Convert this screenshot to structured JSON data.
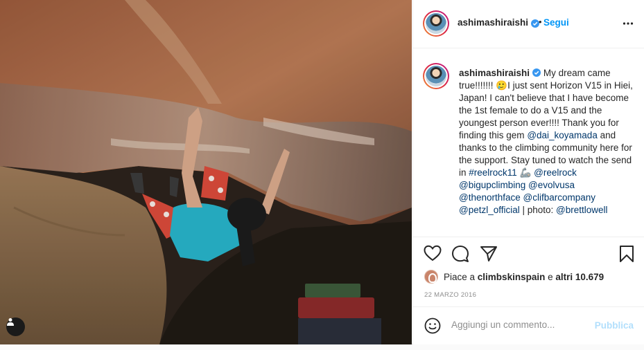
{
  "post": {
    "username": "ashimashiraishi",
    "verified_icon": "verified-badge-icon",
    "separator": "•",
    "follow_label": "Segui",
    "more_icon": "more-options-icon",
    "caption": {
      "username": "ashimashiraishi",
      "t1": "My dream came true!!!!!!! 🥲I just sent Horizon V15 in Hiei, Japan! I can't believe that I have become the 1st female to do a V15 and the youngest person ever!!!! Thank you for finding this gem ",
      "m_dai": "@dai_koyamada",
      "t2": " and thanks to the climbing community here for the support. Stay tuned to watch the send in ",
      "h_reelrock": "#reelrock11",
      "t3": " 🦾 ",
      "m_reelrock": "@reelrock",
      "m_bigup": "@bigupclimbing",
      "m_evolv": "@evolvusa",
      "m_tnf": "@thenorthface",
      "m_clif": "@clifbarcompany",
      "m_petzl": "@petzl_official",
      "t4": " | photo: ",
      "m_brett": "@brettlowell"
    },
    "likes": {
      "prefix": "Piace a ",
      "user": "climbskinspain",
      "middle": " e ",
      "others": "altri 10.679"
    },
    "date": "22 MARZO 2016",
    "comment_placeholder": "Aggiungi un commento...",
    "publish_label": "Pubblica"
  },
  "colors": {
    "link": "#0095f6",
    "mention": "#00376b",
    "publish_disabled": "#b2dffc"
  }
}
